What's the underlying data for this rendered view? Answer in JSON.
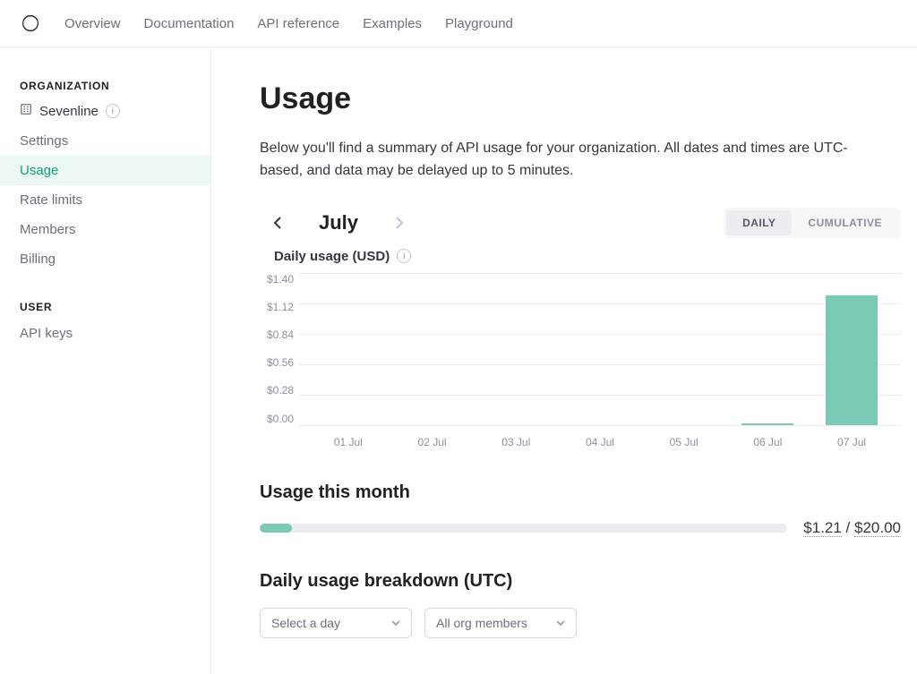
{
  "topnav": {
    "items": [
      "Overview",
      "Documentation",
      "API reference",
      "Examples",
      "Playground"
    ]
  },
  "sidebar": {
    "org_heading": "ORGANIZATION",
    "org_name": "Sevenline",
    "org_items": [
      {
        "label": "Settings",
        "active": false
      },
      {
        "label": "Usage",
        "active": true
      },
      {
        "label": "Rate limits",
        "active": false
      },
      {
        "label": "Members",
        "active": false
      },
      {
        "label": "Billing",
        "active": false
      }
    ],
    "user_heading": "USER",
    "user_items": [
      {
        "label": "API keys"
      }
    ]
  },
  "page": {
    "title": "Usage",
    "intro": "Below you'll find a summary of API usage for your organization. All dates and times are UTC-based, and data may be delayed up to 5 minutes.",
    "month": "July",
    "toggle": {
      "daily": "DAILY",
      "cumulative": "CUMULATIVE",
      "active": "daily"
    },
    "chart_title": "Daily usage (USD)",
    "usage_month_heading": "Usage this month",
    "spent": "$1.21",
    "slash": " / ",
    "limit": "$20.00",
    "progress_pct": 6.05,
    "breakdown_heading": "Daily usage breakdown (UTC)",
    "select_day_placeholder": "Select a day",
    "select_user_value": "All org members"
  },
  "chart_data": {
    "type": "bar",
    "title": "Daily usage (USD)",
    "xlabel": "",
    "ylabel": "USD",
    "ylim": [
      0,
      1.4
    ],
    "yticks": [
      0.0,
      0.28,
      0.56,
      0.84,
      1.12,
      1.4
    ],
    "ytick_labels": [
      "$0.00",
      "$0.28",
      "$0.56",
      "$0.84",
      "$1.12",
      "$1.40"
    ],
    "categories": [
      "01 Jul",
      "02 Jul",
      "03 Jul",
      "04 Jul",
      "05 Jul",
      "06 Jul",
      "07 Jul"
    ],
    "values": [
      0.0,
      0.0,
      0.0,
      0.0,
      0.0,
      0.01,
      1.2
    ]
  }
}
